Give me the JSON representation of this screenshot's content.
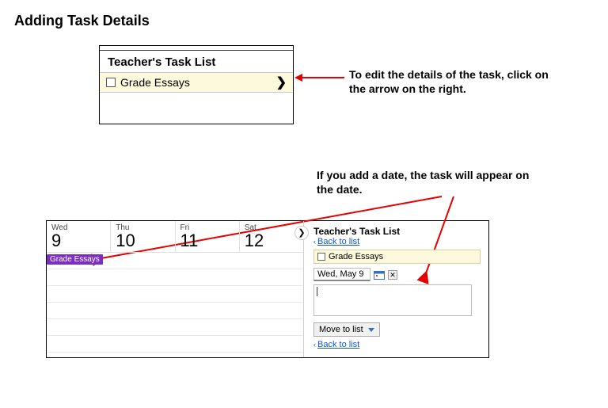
{
  "title": "Adding Task Details",
  "tasklist": {
    "heading": "Teacher's Task List",
    "task_label": "Grade Essays",
    "chevron": "❯"
  },
  "caption_edit": "To edit the details of the task, click on the arrow on the right.",
  "caption_date": "If you add a date, the task will appear on the date.",
  "calendar": {
    "days": [
      {
        "dow": "Wed",
        "num": "9"
      },
      {
        "dow": "Thu",
        "num": "10"
      },
      {
        "dow": "Fri",
        "num": "11"
      },
      {
        "dow": "Sat",
        "num": "12"
      }
    ],
    "event": "Grade Essays"
  },
  "panel": {
    "title": "Teacher's Task List",
    "back": "Back to list",
    "task": "Grade Essays",
    "date": "Wed, May 9",
    "move": "Move to list",
    "collapse": "❯"
  }
}
